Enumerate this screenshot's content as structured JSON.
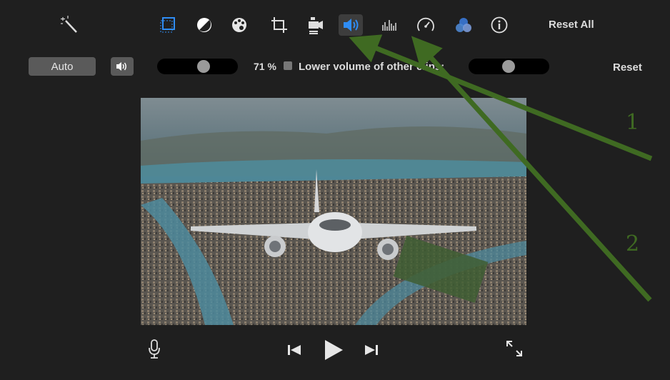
{
  "toolbar": {
    "tools": [
      {
        "name": "color-balance-tool",
        "icon": "magic-wand-icon"
      },
      {
        "name": "crop-rect-tool",
        "icon": "frame-icon"
      },
      {
        "name": "color-correction-tool",
        "icon": "half-circle-icon"
      },
      {
        "name": "palette-tool",
        "icon": "palette-icon"
      },
      {
        "name": "crop-tool",
        "icon": "crop-icon"
      },
      {
        "name": "stabilization-tool",
        "icon": "camera-icon"
      },
      {
        "name": "volume-tool",
        "icon": "speaker-icon",
        "active": true
      },
      {
        "name": "equalizer-tool",
        "icon": "equalizer-icon"
      },
      {
        "name": "speed-tool",
        "icon": "speedometer-icon"
      },
      {
        "name": "filter-tool",
        "icon": "color-circles-icon"
      },
      {
        "name": "info-tool",
        "icon": "info-icon"
      }
    ],
    "reset_all_label": "Reset All"
  },
  "audio_controls": {
    "auto_label": "Auto",
    "volume_percent_label": "71 %",
    "volume_value": 0.71,
    "lower_others_label": "Lower volume of other clips:",
    "lower_others_checked": false,
    "lower_others_level": 0.5,
    "reset_label": "Reset"
  },
  "annotations": {
    "arrow_color": "#3f6a22",
    "labels": [
      "1",
      "2"
    ]
  },
  "colors": {
    "accent": "#2f8df5",
    "background": "#1f1f1f"
  }
}
